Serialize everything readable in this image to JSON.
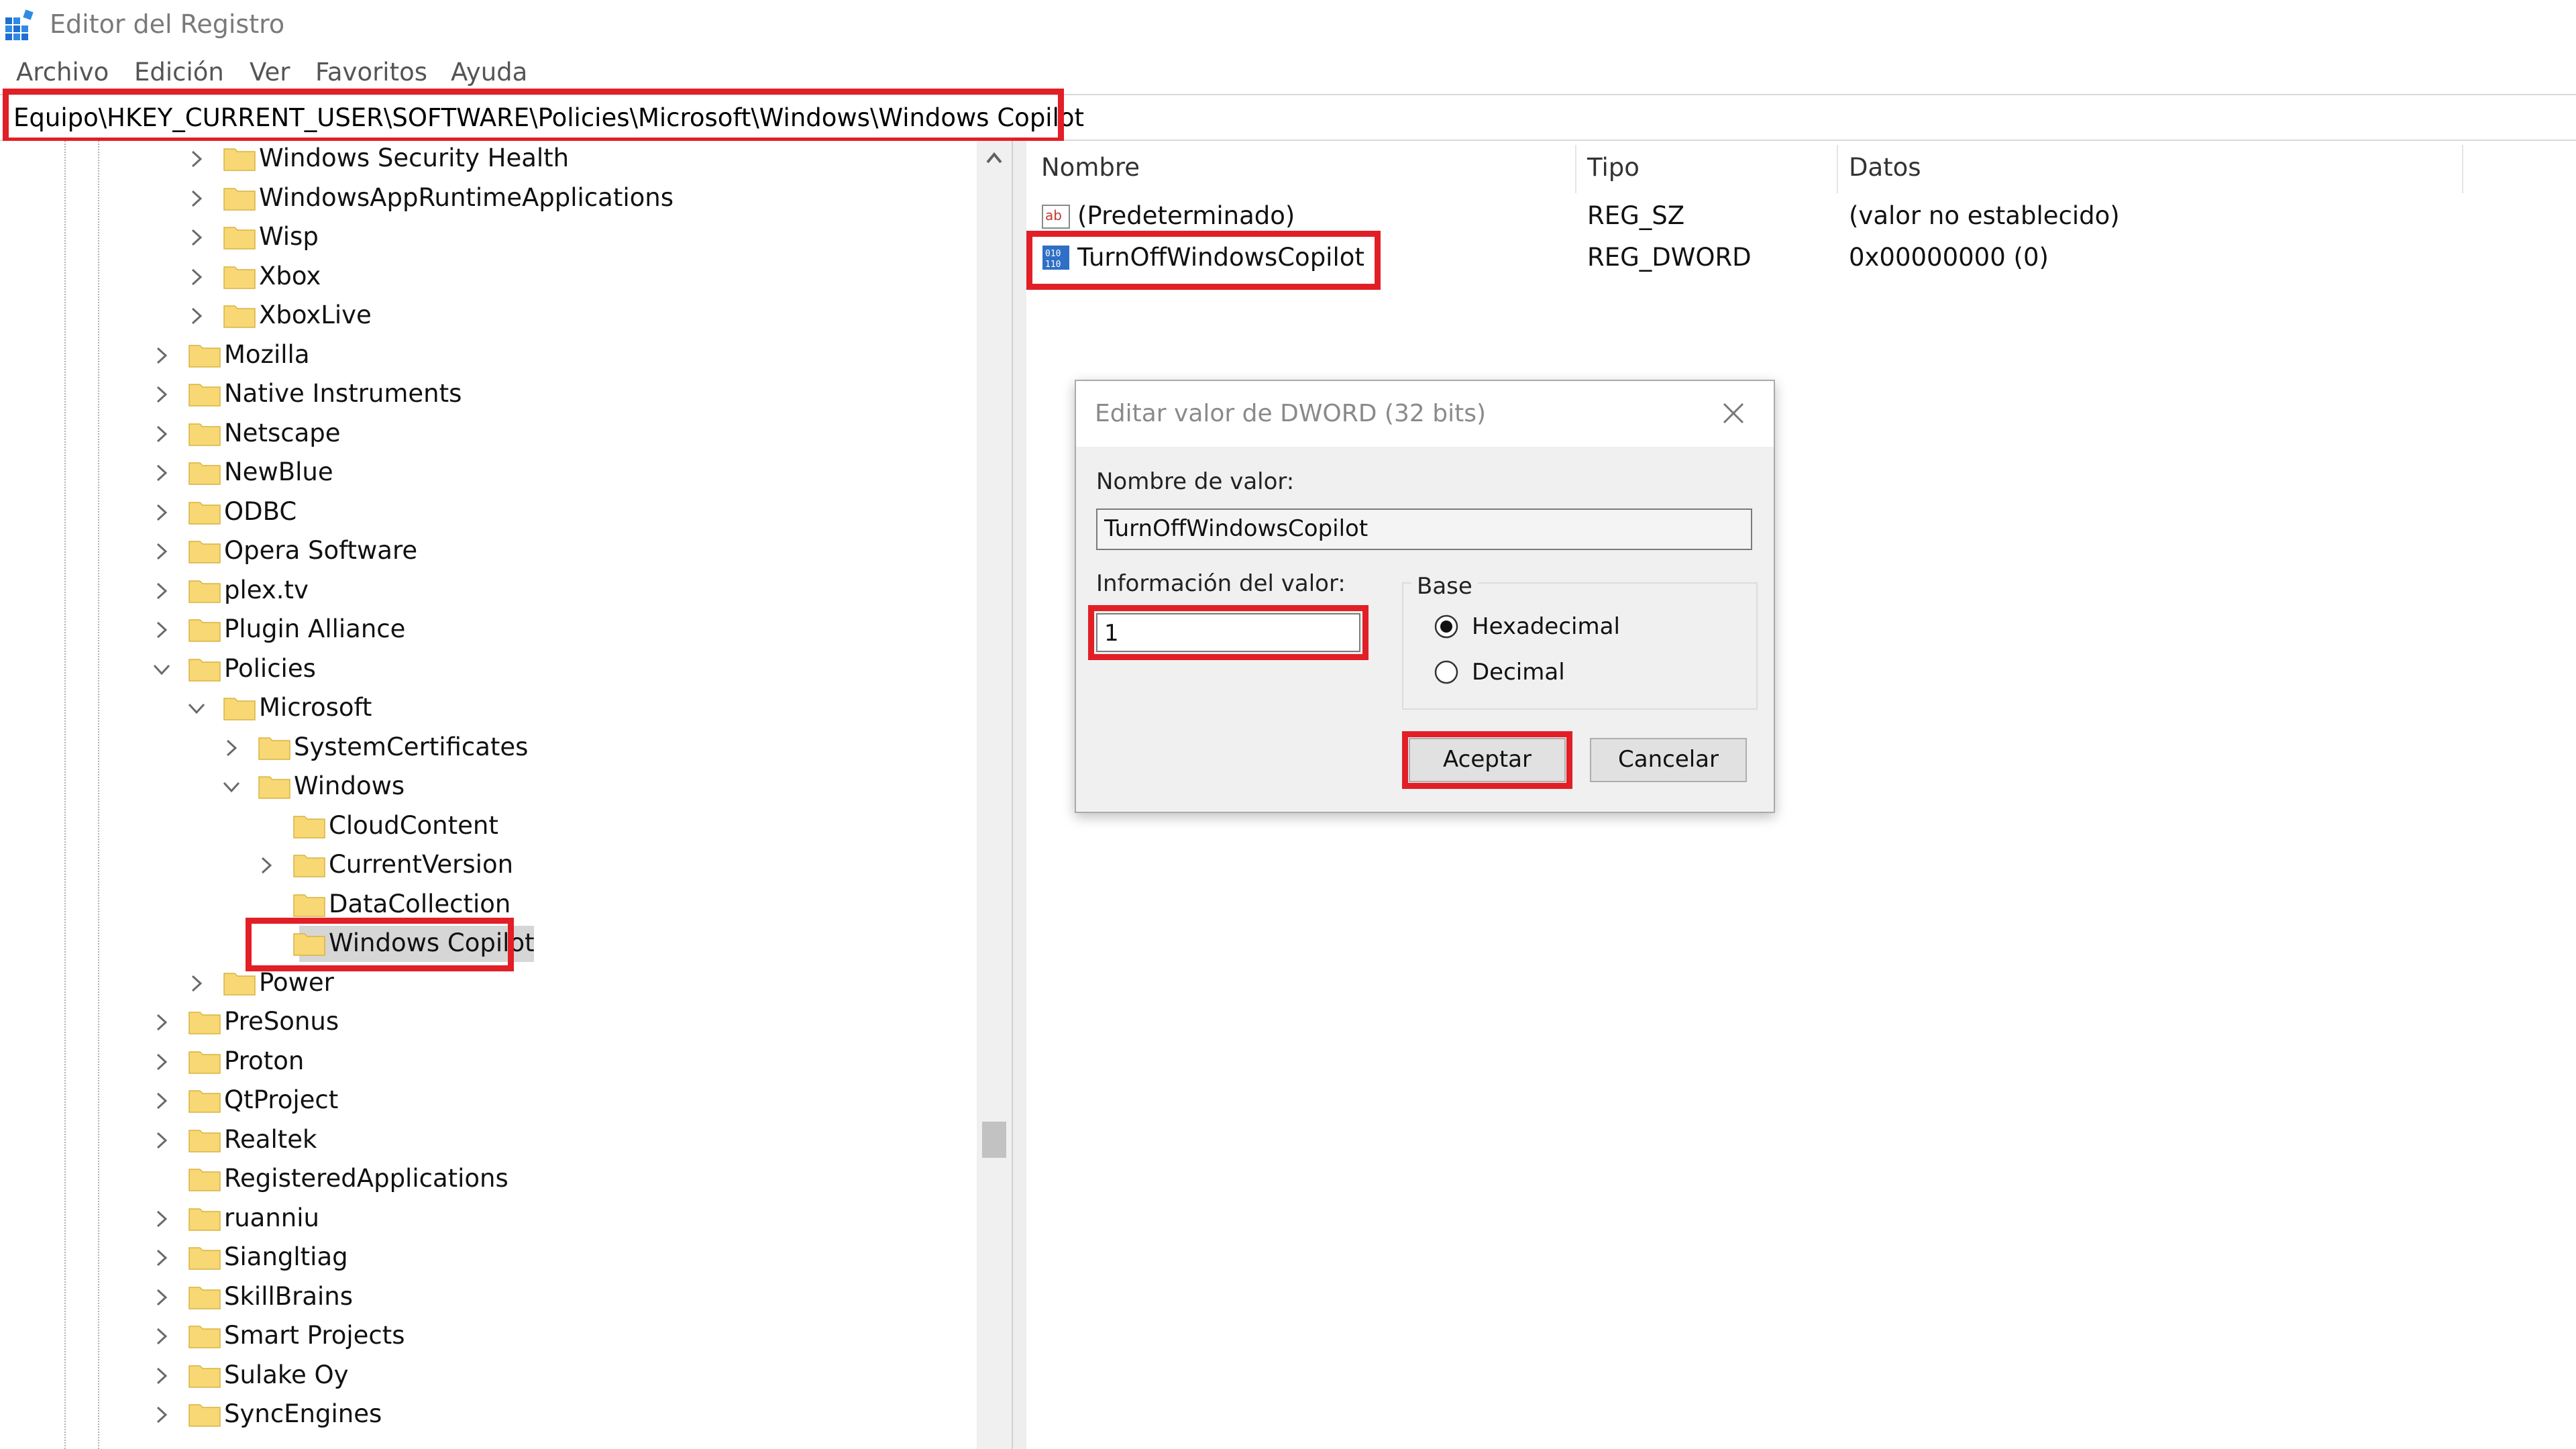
{
  "window": {
    "title": "Editor del Registro"
  },
  "menu": [
    "Archivo",
    "Edición",
    "Ver",
    "Favoritos",
    "Ayuda"
  ],
  "address": "Equipo\\HKEY_CURRENT_USER\\SOFTWARE\\Policies\\Microsoft\\Windows\\Windows Copilot",
  "tree": [
    {
      "label": "Windows Security Health",
      "depth": 1,
      "expander": "collapsed"
    },
    {
      "label": "WindowsAppRuntimeApplications",
      "depth": 1,
      "expander": "collapsed"
    },
    {
      "label": "Wisp",
      "depth": 1,
      "expander": "collapsed"
    },
    {
      "label": "Xbox",
      "depth": 1,
      "expander": "collapsed"
    },
    {
      "label": "XboxLive",
      "depth": 1,
      "expander": "collapsed"
    },
    {
      "label": "Mozilla",
      "depth": 0,
      "expander": "collapsed"
    },
    {
      "label": "Native Instruments",
      "depth": 0,
      "expander": "collapsed"
    },
    {
      "label": "Netscape",
      "depth": 0,
      "expander": "collapsed"
    },
    {
      "label": "NewBlue",
      "depth": 0,
      "expander": "collapsed"
    },
    {
      "label": "ODBC",
      "depth": 0,
      "expander": "collapsed"
    },
    {
      "label": "Opera Software",
      "depth": 0,
      "expander": "collapsed"
    },
    {
      "label": "plex.tv",
      "depth": 0,
      "expander": "collapsed"
    },
    {
      "label": "Plugin Alliance",
      "depth": 0,
      "expander": "collapsed"
    },
    {
      "label": "Policies",
      "depth": 0,
      "expander": "expanded"
    },
    {
      "label": "Microsoft",
      "depth": 1,
      "expander": "expanded"
    },
    {
      "label": "SystemCertificates",
      "depth": 2,
      "expander": "collapsed"
    },
    {
      "label": "Windows",
      "depth": 2,
      "expander": "expanded"
    },
    {
      "label": "CloudContent",
      "depth": 3,
      "expander": "none"
    },
    {
      "label": "CurrentVersion",
      "depth": 3,
      "expander": "collapsed"
    },
    {
      "label": "DataCollection",
      "depth": 3,
      "expander": "none"
    },
    {
      "label": "Windows Copilot",
      "depth": 3,
      "expander": "none",
      "selected": true
    },
    {
      "label": "Power",
      "depth": 1,
      "expander": "collapsed"
    },
    {
      "label": "PreSonus",
      "depth": 0,
      "expander": "collapsed"
    },
    {
      "label": "Proton",
      "depth": 0,
      "expander": "collapsed"
    },
    {
      "label": "QtProject",
      "depth": 0,
      "expander": "collapsed"
    },
    {
      "label": "Realtek",
      "depth": 0,
      "expander": "collapsed"
    },
    {
      "label": "RegisteredApplications",
      "depth": 0,
      "expander": "none"
    },
    {
      "label": "ruanniu",
      "depth": 0,
      "expander": "collapsed"
    },
    {
      "label": "Siangltiag",
      "depth": 0,
      "expander": "collapsed"
    },
    {
      "label": "SkillBrains",
      "depth": 0,
      "expander": "collapsed"
    },
    {
      "label": "Smart Projects",
      "depth": 0,
      "expander": "collapsed"
    },
    {
      "label": "Sulake Oy",
      "depth": 0,
      "expander": "collapsed"
    },
    {
      "label": "SyncEngines",
      "depth": 0,
      "expander": "collapsed"
    }
  ],
  "list": {
    "columns": [
      "Nombre",
      "Tipo",
      "Datos"
    ],
    "rows": [
      {
        "name": "(Predeterminado)",
        "type": "REG_SZ",
        "data": "(valor no establecido)",
        "icon": "string-value-icon"
      },
      {
        "name": "TurnOffWindowsCopilot",
        "type": "REG_DWORD",
        "data": "0x00000000 (0)",
        "icon": "dword-value-icon"
      }
    ]
  },
  "dialog": {
    "title": "Editar valor de DWORD (32 bits)",
    "value_name_label": "Nombre de valor:",
    "value_name": "TurnOffWindowsCopilot",
    "value_data_label": "Información del valor:",
    "value_data": "1",
    "base_label": "Base",
    "hex_label": "Hexadecimal",
    "dec_label": "Decimal",
    "base_selected": "Hexadecimal",
    "ok_label": "Aceptar",
    "cancel_label": "Cancelar"
  },
  "colors": {
    "highlight": "#e21f26",
    "folder": "#f8d775",
    "selection": "#d6d6d6"
  }
}
